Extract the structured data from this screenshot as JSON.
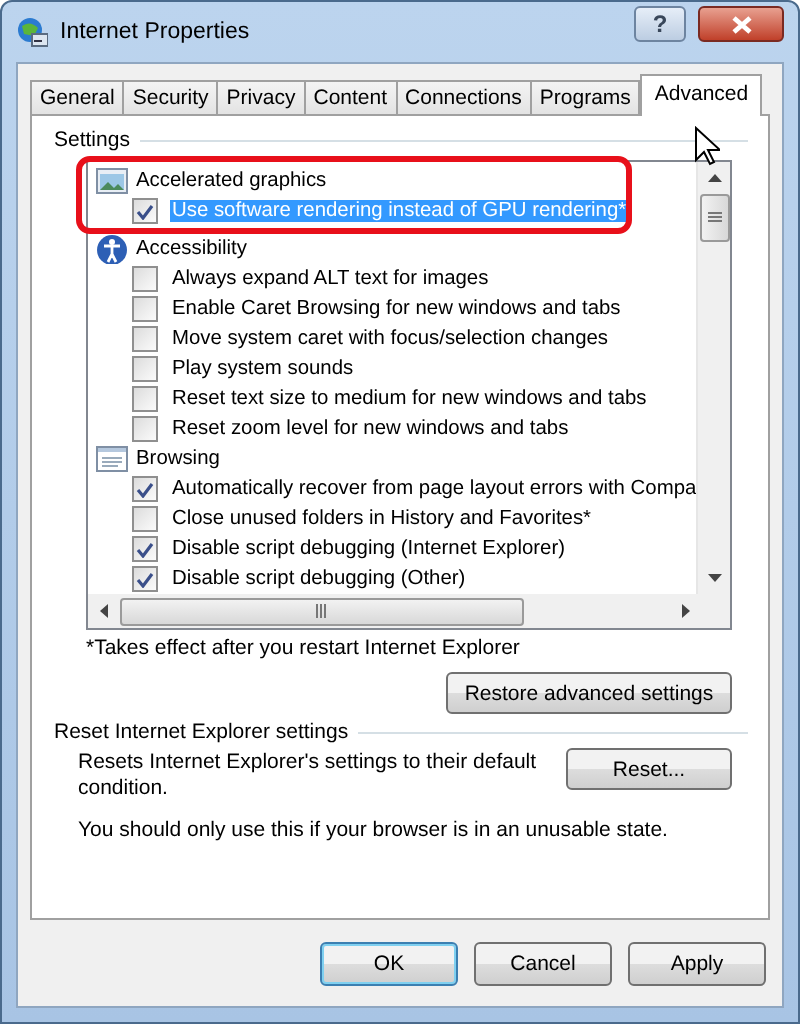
{
  "window": {
    "title": "Internet Properties",
    "help": "?"
  },
  "tabs": [
    {
      "label": "General",
      "selected": false
    },
    {
      "label": "Security",
      "selected": false
    },
    {
      "label": "Privacy",
      "selected": false
    },
    {
      "label": "Content",
      "selected": false
    },
    {
      "label": "Connections",
      "selected": false
    },
    {
      "label": "Programs",
      "selected": false
    },
    {
      "label": "Advanced",
      "selected": true
    }
  ],
  "settings": {
    "label": "Settings",
    "categories": [
      {
        "label": "Accelerated graphics",
        "kind": "graphics",
        "children": [
          {
            "label": "Use software rendering instead of GPU rendering*",
            "checked": true,
            "selected": true
          }
        ]
      },
      {
        "label": "Accessibility",
        "kind": "accessibility",
        "children": [
          {
            "label": "Always expand ALT text for images",
            "checked": false,
            "selected": false
          },
          {
            "label": "Enable Caret Browsing for new windows and tabs",
            "checked": false,
            "selected": false
          },
          {
            "label": "Move system caret with focus/selection changes",
            "checked": false,
            "selected": false
          },
          {
            "label": "Play system sounds",
            "checked": false,
            "selected": false
          },
          {
            "label": "Reset text size to medium for new windows and tabs",
            "checked": false,
            "selected": false
          },
          {
            "label": "Reset zoom level for new windows and tabs",
            "checked": false,
            "selected": false
          }
        ]
      },
      {
        "label": "Browsing",
        "kind": "browsing",
        "children": [
          {
            "label": "Automatically recover from page layout errors with Compa",
            "checked": true,
            "selected": false
          },
          {
            "label": "Close unused folders in History and Favorites*",
            "checked": false,
            "selected": false
          },
          {
            "label": "Disable script debugging (Internet Explorer)",
            "checked": true,
            "selected": false
          },
          {
            "label": "Disable script debugging (Other)",
            "checked": true,
            "selected": false
          }
        ]
      }
    ]
  },
  "note": "*Takes effect after you restart Internet Explorer",
  "restore_button": "Restore advanced settings",
  "reset_group": {
    "label": "Reset Internet Explorer settings",
    "description": "Resets Internet Explorer's settings to their default condition.",
    "button": "Reset...",
    "warning": "You should only use this if your browser is in an unusable state."
  },
  "buttons": [
    {
      "label": "OK",
      "default": true
    },
    {
      "label": "Cancel",
      "default": false
    },
    {
      "label": "Apply",
      "default": false
    }
  ]
}
